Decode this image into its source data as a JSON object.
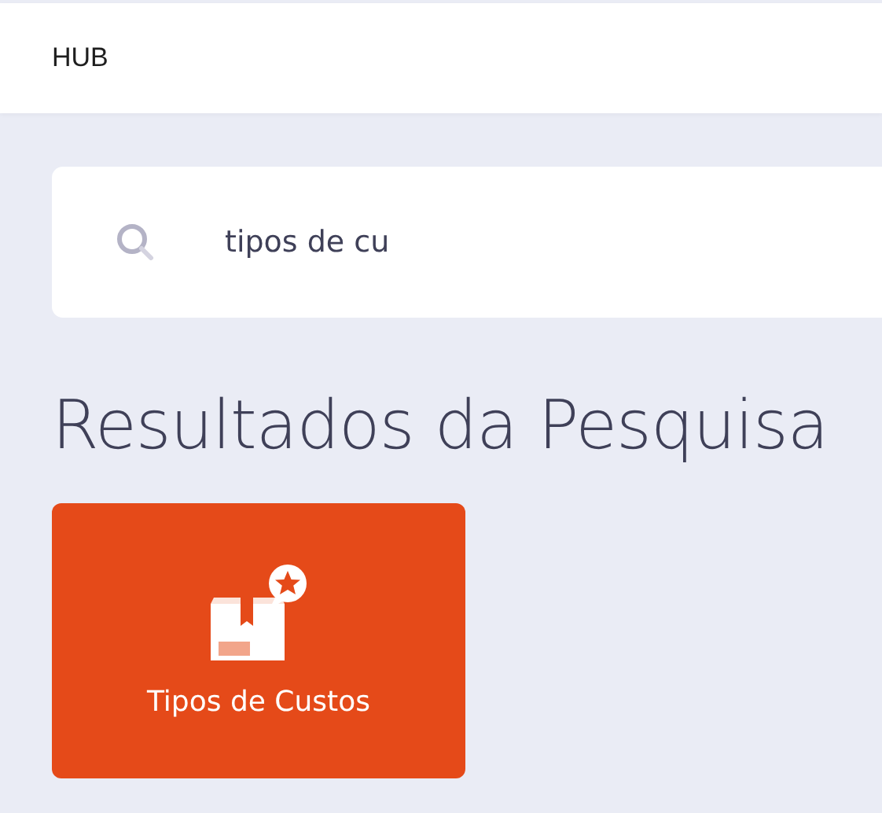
{
  "header": {
    "title": "HUB"
  },
  "search": {
    "value": "tipos de cu"
  },
  "results": {
    "heading": "Resultados da Pesquisa",
    "items": [
      {
        "label": "Tipos de Custos"
      }
    ]
  }
}
